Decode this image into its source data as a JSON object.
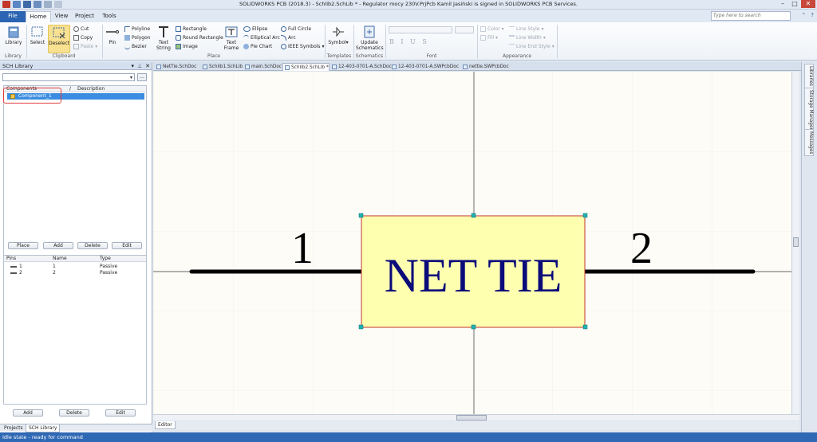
{
  "window": {
    "title": "SOLIDWORKS PCB (2018.3) - Schlib2.SchLib * - Regulator mocy 230V.PrjPcb Kamil Jasiński is signed in SOLIDWORKS PCB Services."
  },
  "menu": {
    "file": "File",
    "home": "Home",
    "view": "View",
    "project": "Project",
    "tools": "Tools",
    "search_placeholder": "Type here to search"
  },
  "ribbon": {
    "library_group": {
      "library_btn": "Library",
      "label": "Library"
    },
    "clipboard_group": {
      "select": "Select",
      "deselect": "Deselect",
      "cut": "Cut",
      "copy": "Copy",
      "paste": "Paste",
      "label": "Clipboard"
    },
    "place_group": {
      "pin": "Pin",
      "polyline": "Polyline",
      "polygon": "Polygon",
      "bezier": "Bezier",
      "text_string": "Text String",
      "rectangle": "Rectangle",
      "round_rectangle": "Round Rectangle",
      "image": "Image",
      "text_frame": "Text Frame",
      "ellipse": "Ellipse",
      "elliptical_arc": "Elliptical Arc",
      "pie_chart": "Pie Chart",
      "full_circle": "Full Circle",
      "arc": "Arc",
      "ieee_symbols": "IEEE Symbols",
      "label": "Place"
    },
    "templates_group": {
      "symbol": "Symbol",
      "label": "Templates"
    },
    "schematics_group": {
      "update": "Update Schematics",
      "label": "Schematics"
    },
    "font_group": {
      "bius": "B I U S",
      "label": "Font"
    },
    "appearance_group": {
      "color": "Color",
      "fill": "Fill",
      "line_style": "Line Style",
      "line_width": "Line Width",
      "line_end_style": "Line End Style",
      "label": "Appearance"
    }
  },
  "panel": {
    "title": "SCH Library",
    "components": {
      "col_components": "Components",
      "col_description": "Description",
      "items": [
        "Component_1"
      ]
    },
    "buttons_top": [
      "Place",
      "Add",
      "Delete",
      "Edit"
    ],
    "pins": {
      "col_pins": "Pins",
      "col_name": "Name",
      "col_type": "Type",
      "rows": [
        {
          "pin": "1",
          "name": "1",
          "type": "Passive"
        },
        {
          "pin": "2",
          "name": "2",
          "type": "Passive"
        }
      ]
    },
    "buttons_bottom": [
      "Add",
      "Delete",
      "Edit"
    ],
    "tabs": [
      "Projects",
      "SCH Library"
    ]
  },
  "doc_tabs": [
    "NetTie.SchDoc",
    "Schlib1.SchLib",
    "main.SchDoc",
    "Schlib2.SchLib *",
    "12-403-0701-A.SchDoc",
    "12-403-0701-A.SWPcbDoc",
    "nettie.SWPcbDoc"
  ],
  "side_tabs": [
    "Libraries",
    "Storage Manager",
    "Messages"
  ],
  "canvas": {
    "component_label": "NET TIE",
    "pin1_label": "1",
    "pin2_label": "2",
    "body_fill": "#ffffb0",
    "body_border": "#c0392b",
    "text_color": "#0b0b7a"
  },
  "editor_tab": "Editor",
  "status": "Idle state - ready for command"
}
